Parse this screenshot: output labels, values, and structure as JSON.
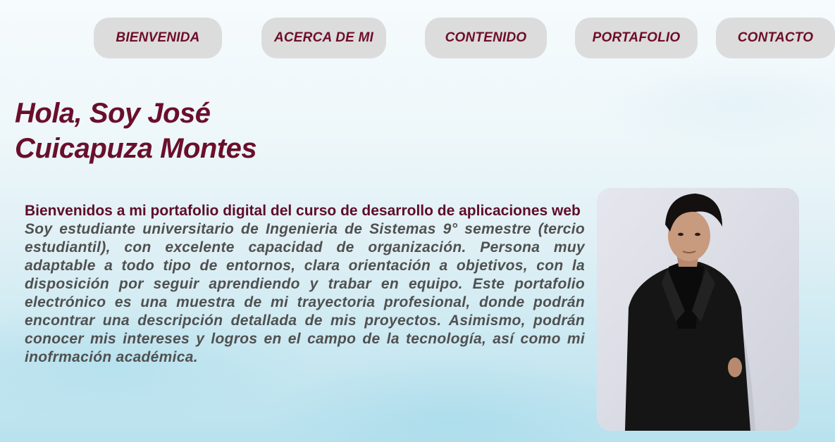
{
  "nav": {
    "items": [
      {
        "label": "BIENVENIDA"
      },
      {
        "label": "ACERCA DE MI"
      },
      {
        "label": "CONTENIDO"
      },
      {
        "label": "PORTAFOLIO"
      },
      {
        "label": "CONTACTO"
      }
    ]
  },
  "hero": {
    "title_line1": "Hola, Soy José",
    "title_line2": "Cuicapuza Montes"
  },
  "intro": {
    "heading": "Bienvenidos a mi portafolio digital del curso de desarrollo de aplicaciones web",
    "body": "Soy estudiante universitario de Ingenieria de Sistemas 9° semestre (tercio estudiantil), con excelente capacidad de organización. Persona muy adaptable a todo tipo de entornos, clara orientación a objetivos, con la disposición por seguir aprendiendo y trabar en equipo. Este portafolio electrónico es una muestra de mi trayectoria profesional, donde podrán encontrar una descripción detallada de mis proyectos. Asimismo, podrán conocer mis intereses y logros en el campo de la tecnología, así como mi inofrmación académica."
  },
  "colors": {
    "accent": "#6a0f2b",
    "nav_bg": "#dcdcdc",
    "body_text": "#505050"
  }
}
